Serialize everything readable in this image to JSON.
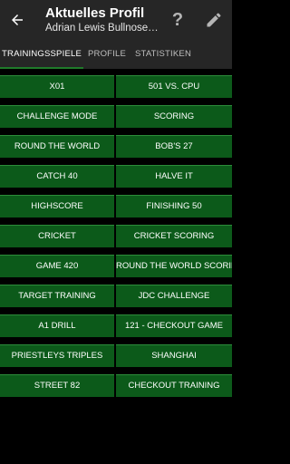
{
  "header": {
    "title": "Aktuelles Profil",
    "subtitle": "Adrian Lewis Bullnose…",
    "help_label": "?"
  },
  "tabs": [
    {
      "label": "TRAININGSSPIELE",
      "active": true
    },
    {
      "label": "PROFILE",
      "active": false
    },
    {
      "label": "STATISTIKEN",
      "active": false
    }
  ],
  "games": [
    [
      "X01",
      "501 VS. CPU"
    ],
    [
      "CHALLENGE MODE",
      "SCORING"
    ],
    [
      "ROUND THE WORLD",
      "BOB'S 27"
    ],
    [
      "CATCH 40",
      "HALVE IT"
    ],
    [
      "HIGHSCORE",
      "FINISHING 50"
    ],
    [
      "CRICKET",
      "CRICKET SCORING"
    ],
    [
      "GAME 420",
      "ROUND THE WORLD SCORING"
    ],
    [
      "TARGET TRAINING",
      "JDC CHALLENGE"
    ],
    [
      "A1 DRILL",
      "121 - CHECKOUT GAME"
    ],
    [
      "PRIESTLEYS TRIPLES",
      "SHANGHAI"
    ],
    [
      "STREET 82",
      "CHECKOUT TRAINING"
    ]
  ],
  "colors": {
    "button": "#0c5a1a",
    "appbar": "#262626",
    "background": "#000000"
  },
  "icons": [
    "back-arrow-icon",
    "help-icon",
    "edit-pencil-icon"
  ]
}
